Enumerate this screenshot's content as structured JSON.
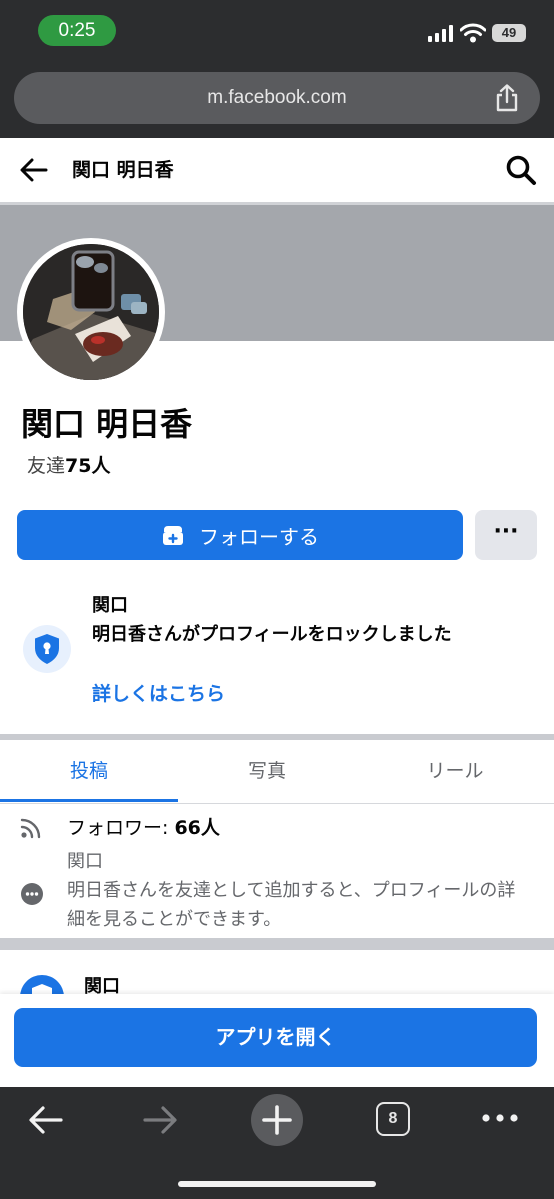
{
  "status_bar": {
    "time": "0:25",
    "battery": "49"
  },
  "browser": {
    "url": "m.facebook.com",
    "tab_count": "8"
  },
  "header": {
    "title": "関口 明日香"
  },
  "profile": {
    "name": "関口 明日香",
    "friends_prefix": "友達",
    "friends_count": "75人",
    "follow_label": "フォローする",
    "more_label": "···"
  },
  "lock_notice": {
    "title": "関口",
    "text": "明日香さんがプロフィールをロックしました",
    "link": "詳しくはこちら"
  },
  "tabs": [
    {
      "label": "投稿",
      "active": true
    },
    {
      "label": "写真",
      "active": false
    },
    {
      "label": "リール",
      "active": false
    }
  ],
  "followers": {
    "label": "フォロワー: ",
    "count": "66人"
  },
  "info": {
    "name": "関口",
    "text": "明日香さんを友達として追加すると、プロフィールの詳細を見ることができます。"
  },
  "card2": {
    "title": "関口"
  },
  "open_app": {
    "label": "アプリを開く"
  },
  "colors": {
    "accent": "#1b74e4",
    "chrome": "#2c2d2f"
  }
}
